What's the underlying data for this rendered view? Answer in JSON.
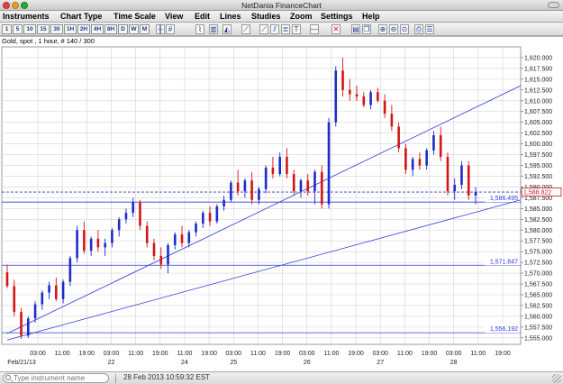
{
  "window": {
    "title": "NetDania FinanceChart"
  },
  "menu": [
    "Instruments",
    "Chart Type",
    "Time Scale",
    "View",
    "Edit",
    "Lines",
    "Studies",
    "Zoom",
    "Settings",
    "Help"
  ],
  "toolbar": {
    "timescales": [
      "1",
      "5",
      "10",
      "15",
      "30",
      "1H",
      "2H",
      "4H",
      "8H",
      "D",
      "W",
      "M"
    ],
    "tools": [
      {
        "icon": "bar-chart-icon",
        "glyph": "╫"
      },
      {
        "icon": "grid-icon",
        "glyph": "#"
      },
      {
        "icon": "line-chart-icon",
        "glyph": "⌇"
      },
      {
        "icon": "candles-icon",
        "glyph": "▥"
      },
      {
        "icon": "area-chart-icon",
        "glyph": "◭"
      },
      {
        "icon": "draw-line-icon",
        "glyph": "⟋"
      },
      {
        "icon": "trend-line-icon",
        "glyph": "⟋"
      },
      {
        "icon": "channel-icon",
        "glyph": "⫽"
      },
      {
        "icon": "fibonacci-icon",
        "glyph": "≣"
      },
      {
        "icon": "text-tool-icon",
        "glyph": "T"
      },
      {
        "icon": "horizontal-line-icon",
        "glyph": "—"
      },
      {
        "icon": "delete-line-icon",
        "glyph": "✕"
      },
      {
        "icon": "properties-icon",
        "glyph": "▤"
      },
      {
        "icon": "copy-icon",
        "glyph": "❐"
      },
      {
        "icon": "zoom-in-icon",
        "glyph": "⊕"
      },
      {
        "icon": "zoom-out-icon",
        "glyph": "⊖"
      },
      {
        "icon": "zoom-fit-icon",
        "glyph": "⊙"
      },
      {
        "icon": "print-icon",
        "glyph": "⎙"
      },
      {
        "icon": "settings-icon",
        "glyph": "☰"
      }
    ]
  },
  "chart_header": "Gold, spot , 1 hour, # 140 / 300",
  "statusbar": {
    "search_placeholder": "Type instrument name",
    "timestamp": "28 Feb 2013 10:59:32 EST"
  },
  "colors": {
    "up": "#1d2cc9",
    "down": "#d41515",
    "lines": "#2b39d8",
    "grid": "#d3d3d3"
  },
  "chart_data": {
    "type": "candlestick",
    "instrument": "Gold, spot",
    "interval": "1 hour",
    "ylim": [
      1553.5,
      1622.5
    ],
    "y_ticks": [
      1555,
      1557.5,
      1560,
      1562.5,
      1565,
      1567.5,
      1570,
      1572.5,
      1575,
      1577.5,
      1580,
      1582.5,
      1585,
      1587.5,
      1590,
      1592.5,
      1595,
      1597.5,
      1600,
      1602.5,
      1605,
      1607.5,
      1610,
      1612.5,
      1615,
      1617.5,
      1620
    ],
    "x_ticks": [
      "03:00",
      "11:00",
      "19:00",
      "03:00",
      "11:00",
      "19:00",
      "11:00",
      "19:00",
      "03:00",
      "11:00",
      "19:00",
      "03:00",
      "11:00",
      "19:00",
      "03:00",
      "11:00",
      "19:00",
      "03:00",
      "11:00",
      "19:00"
    ],
    "x_dates": [
      {
        "label": "Feb/21/13",
        "at": 0
      },
      {
        "label": "22",
        "at": 3
      },
      {
        "label": "24",
        "at": 6
      },
      {
        "label": "25",
        "at": 8
      },
      {
        "label": "26",
        "at": 11
      },
      {
        "label": "27",
        "at": 14
      },
      {
        "label": "28",
        "at": 17
      }
    ],
    "horizontal_levels": [
      {
        "value": 1586.495,
        "label": "1,586.495",
        "style": "solid"
      },
      {
        "value": 1571.847,
        "label": "1,571.847",
        "style": "solid"
      },
      {
        "value": 1556.192,
        "label": "1,556.192",
        "style": "solid"
      },
      {
        "value": 1588.822,
        "label": "1,588.822",
        "style": "dashed",
        "current": true
      }
    ],
    "trend_lines": [
      {
        "from": [
          0,
          1556.0
        ],
        "to": [
          1,
          1613.5
        ]
      },
      {
        "from": [
          0,
          1554.5
        ],
        "to": [
          1,
          1587.0
        ]
      }
    ],
    "candles": [
      [
        1570.2,
        1572.0,
        1566.5,
        1567.0
      ],
      [
        1567.0,
        1568.5,
        1560.0,
        1561.0
      ],
      [
        1561.0,
        1562.0,
        1554.8,
        1555.5
      ],
      [
        1555.5,
        1560.0,
        1555.0,
        1559.5
      ],
      [
        1559.5,
        1563.5,
        1558.5,
        1562.8
      ],
      [
        1562.8,
        1566.0,
        1561.5,
        1565.5
      ],
      [
        1565.5,
        1568.0,
        1564.0,
        1567.2
      ],
      [
        1567.2,
        1569.0,
        1563.5,
        1564.0
      ],
      [
        1564.0,
        1568.5,
        1563.0,
        1568.0
      ],
      [
        1568.0,
        1574.0,
        1567.0,
        1573.5
      ],
      [
        1573.5,
        1581.0,
        1572.5,
        1580.0
      ],
      [
        1580.0,
        1582.0,
        1574.5,
        1575.2
      ],
      [
        1575.2,
        1578.5,
        1574.0,
        1578.0
      ],
      [
        1578.0,
        1580.0,
        1575.0,
        1576.0
      ],
      [
        1576.0,
        1578.0,
        1574.0,
        1577.0
      ],
      [
        1577.0,
        1580.5,
        1576.0,
        1580.0
      ],
      [
        1580.0,
        1583.0,
        1578.5,
        1582.5
      ],
      [
        1582.5,
        1585.0,
        1581.5,
        1584.0
      ],
      [
        1584.0,
        1587.5,
        1583.0,
        1586.5
      ],
      [
        1586.5,
        1587.0,
        1580.0,
        1581.0
      ],
      [
        1581.0,
        1582.0,
        1576.0,
        1577.0
      ],
      [
        1577.0,
        1578.0,
        1573.0,
        1574.0
      ],
      [
        1574.0,
        1576.0,
        1571.0,
        1572.0
      ],
      [
        1572.0,
        1577.0,
        1570.0,
        1576.5
      ],
      [
        1576.5,
        1579.5,
        1575.5,
        1579.0
      ],
      [
        1579.0,
        1581.0,
        1576.0,
        1577.0
      ],
      [
        1577.0,
        1580.0,
        1576.0,
        1579.5
      ],
      [
        1579.5,
        1582.0,
        1578.5,
        1581.5
      ],
      [
        1581.5,
        1584.5,
        1580.5,
        1584.0
      ],
      [
        1584.0,
        1585.5,
        1581.0,
        1582.0
      ],
      [
        1582.0,
        1586.0,
        1581.5,
        1585.5
      ],
      [
        1585.5,
        1588.0,
        1584.5,
        1587.0
      ],
      [
        1587.0,
        1591.5,
        1586.5,
        1591.0
      ],
      [
        1591.0,
        1594.0,
        1588.0,
        1589.0
      ],
      [
        1589.0,
        1592.0,
        1587.5,
        1591.5
      ],
      [
        1591.5,
        1593.5,
        1586.0,
        1587.0
      ],
      [
        1587.0,
        1590.0,
        1586.0,
        1589.5
      ],
      [
        1589.5,
        1595.0,
        1588.5,
        1594.5
      ],
      [
        1594.5,
        1597.0,
        1592.0,
        1593.0
      ],
      [
        1593.0,
        1598.0,
        1592.5,
        1597.0
      ],
      [
        1597.0,
        1599.0,
        1592.0,
        1593.0
      ],
      [
        1593.0,
        1594.0,
        1588.0,
        1589.0
      ],
      [
        1589.0,
        1592.0,
        1587.5,
        1591.5
      ],
      [
        1591.5,
        1593.0,
        1588.0,
        1589.0
      ],
      [
        1589.0,
        1594.0,
        1586.0,
        1593.5
      ],
      [
        1593.5,
        1595.0,
        1585.0,
        1586.0
      ],
      [
        1586.0,
        1606.0,
        1585.0,
        1605.0
      ],
      [
        1605.0,
        1618.0,
        1604.0,
        1617.0
      ],
      [
        1617.0,
        1620.0,
        1611.0,
        1612.5
      ],
      [
        1612.5,
        1615.0,
        1610.0,
        1611.5
      ],
      [
        1611.5,
        1613.5,
        1610.0,
        1611.0
      ],
      [
        1611.0,
        1612.0,
        1608.5,
        1609.0
      ],
      [
        1609.0,
        1612.5,
        1608.0,
        1612.0
      ],
      [
        1612.0,
        1613.0,
        1609.5,
        1610.0
      ],
      [
        1610.0,
        1611.5,
        1606.0,
        1607.0
      ],
      [
        1607.0,
        1609.0,
        1603.0,
        1604.0
      ],
      [
        1604.0,
        1605.0,
        1598.0,
        1599.0
      ],
      [
        1599.0,
        1600.0,
        1593.0,
        1594.0
      ],
      [
        1594.0,
        1597.0,
        1592.5,
        1596.5
      ],
      [
        1596.5,
        1598.0,
        1594.0,
        1595.0
      ],
      [
        1595.0,
        1599.0,
        1594.0,
        1598.5
      ],
      [
        1598.5,
        1603.0,
        1597.5,
        1602.0
      ],
      [
        1602.0,
        1604.0,
        1596.0,
        1597.0
      ],
      [
        1597.0,
        1598.0,
        1588.0,
        1589.0
      ],
      [
        1589.0,
        1592.0,
        1587.0,
        1590.5
      ],
      [
        1590.5,
        1596.0,
        1589.5,
        1595.0
      ],
      [
        1595.0,
        1596.0,
        1587.0,
        1588.0
      ],
      [
        1588.0,
        1590.0,
        1586.0,
        1588.8
      ]
    ]
  }
}
